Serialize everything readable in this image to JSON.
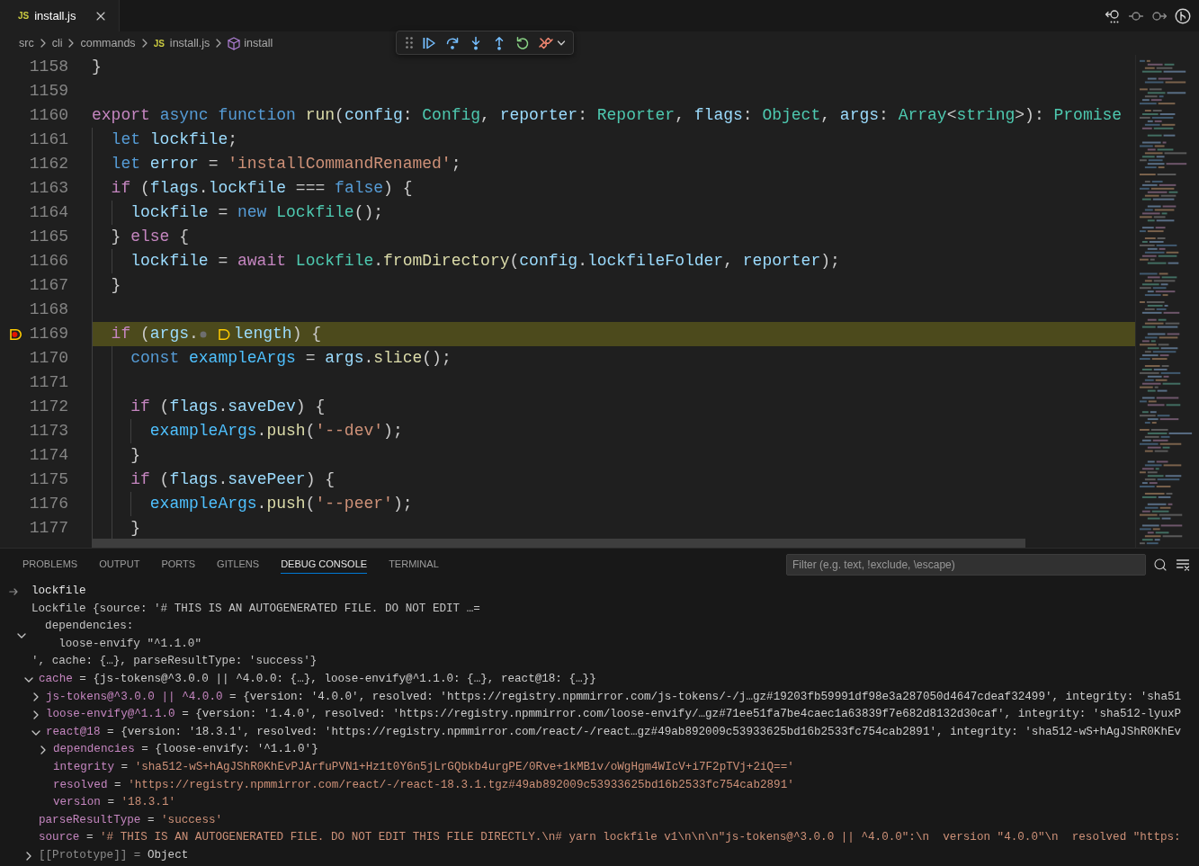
{
  "tabs": [
    {
      "file_icon": "JS",
      "label": "install.js",
      "selected": true
    }
  ],
  "breadcrumb": [
    {
      "label": "src",
      "kind": "folder"
    },
    {
      "label": "cli",
      "kind": "folder"
    },
    {
      "label": "commands",
      "kind": "folder"
    },
    {
      "label": "install.js",
      "kind": "file",
      "file_icon": "JS"
    },
    {
      "label": "install",
      "kind": "symbol"
    }
  ],
  "editor": {
    "lines": [
      {
        "number": "1158",
        "current": false,
        "breakpoint": false,
        "tokens": [
          {
            "text": "}",
            "kind": "plain"
          }
        ]
      },
      {
        "number": "1159",
        "current": false,
        "breakpoint": false
      },
      {
        "number": "1160",
        "current": false,
        "breakpoint": false,
        "tokens": [
          {
            "text": "export ",
            "kind": "control"
          },
          {
            "text": "async ",
            "kind": "keyword"
          },
          {
            "text": "function ",
            "kind": "keyword"
          },
          {
            "text": "run",
            "kind": "function"
          },
          {
            "text": "(",
            "kind": "plain"
          },
          {
            "text": "config",
            "kind": "variable"
          },
          {
            "text": ": ",
            "kind": "plain"
          },
          {
            "text": "Config",
            "kind": "type"
          },
          {
            "text": ", ",
            "kind": "plain"
          },
          {
            "text": "reporter",
            "kind": "variable"
          },
          {
            "text": ": ",
            "kind": "plain"
          },
          {
            "text": "Reporter",
            "kind": "type"
          },
          {
            "text": ", ",
            "kind": "plain"
          },
          {
            "text": "flags",
            "kind": "variable"
          },
          {
            "text": ": ",
            "kind": "plain"
          },
          {
            "text": "Object",
            "kind": "type"
          },
          {
            "text": ", ",
            "kind": "plain"
          },
          {
            "text": "args",
            "kind": "variable"
          },
          {
            "text": ": ",
            "kind": "plain"
          },
          {
            "text": "Array",
            "kind": "type"
          },
          {
            "text": "<",
            "kind": "plain"
          },
          {
            "text": "string",
            "kind": "type"
          },
          {
            "text": ">): ",
            "kind": "plain"
          },
          {
            "text": "Promise",
            "kind": "type"
          }
        ]
      },
      {
        "number": "1161",
        "current": false,
        "breakpoint": false,
        "tokens": [
          {
            "text": "  let ",
            "kind": "keyword"
          },
          {
            "text": "lockfile",
            "kind": "variable"
          },
          {
            "text": ";",
            "kind": "plain"
          }
        ]
      },
      {
        "number": "1162",
        "current": false,
        "breakpoint": false,
        "tokens": [
          {
            "text": "  let ",
            "kind": "keyword"
          },
          {
            "text": "error",
            "kind": "variable"
          },
          {
            "text": " = ",
            "kind": "plain"
          },
          {
            "text": "'installCommandRenamed'",
            "kind": "string"
          },
          {
            "text": ";",
            "kind": "plain"
          }
        ]
      },
      {
        "number": "1163",
        "current": false,
        "breakpoint": false,
        "tokens": [
          {
            "text": "  if",
            "kind": "control"
          },
          {
            "text": " (",
            "kind": "plain"
          },
          {
            "text": "flags",
            "kind": "variable"
          },
          {
            "text": ".",
            "kind": "plain"
          },
          {
            "text": "lockfile",
            "kind": "variable"
          },
          {
            "text": " === ",
            "kind": "plain"
          },
          {
            "text": "false",
            "kind": "keyword"
          },
          {
            "text": ") {",
            "kind": "plain"
          }
        ]
      },
      {
        "number": "1164",
        "current": false,
        "breakpoint": false,
        "tokens": [
          {
            "text": "    lockfile",
            "kind": "variable"
          },
          {
            "text": " = ",
            "kind": "plain"
          },
          {
            "text": "new ",
            "kind": "keyword"
          },
          {
            "text": "Lockfile",
            "kind": "type"
          },
          {
            "text": "();",
            "kind": "plain"
          }
        ]
      },
      {
        "number": "1165",
        "current": false,
        "breakpoint": false,
        "tokens": [
          {
            "text": "  } ",
            "kind": "plain"
          },
          {
            "text": "else",
            "kind": "control"
          },
          {
            "text": " {",
            "kind": "plain"
          }
        ]
      },
      {
        "number": "1166",
        "current": false,
        "breakpoint": false,
        "tokens": [
          {
            "text": "    lockfile",
            "kind": "variable"
          },
          {
            "text": " = ",
            "kind": "plain"
          },
          {
            "text": "await ",
            "kind": "control"
          },
          {
            "text": "Lockfile",
            "kind": "type"
          },
          {
            "text": ".",
            "kind": "plain"
          },
          {
            "text": "fromDirectory",
            "kind": "function"
          },
          {
            "text": "(",
            "kind": "plain"
          },
          {
            "text": "config",
            "kind": "variable"
          },
          {
            "text": ".",
            "kind": "plain"
          },
          {
            "text": "lockfileFolder",
            "kind": "variable"
          },
          {
            "text": ", ",
            "kind": "plain"
          },
          {
            "text": "reporter",
            "kind": "variable"
          },
          {
            "text": ");",
            "kind": "plain"
          }
        ]
      },
      {
        "number": "1167",
        "current": false,
        "breakpoint": false,
        "tokens": [
          {
            "text": "  }",
            "kind": "plain"
          }
        ]
      },
      {
        "number": "1168",
        "current": false,
        "breakpoint": false
      },
      {
        "number": "1169",
        "current": true,
        "breakpoint": true,
        "tokens": [
          {
            "text": "  if",
            "kind": "control"
          },
          {
            "text": " (",
            "kind": "plain"
          },
          {
            "text": "args",
            "kind": "variable"
          },
          {
            "text": ".",
            "kind": "plain"
          },
          {
            "kind": "breakpoint-dot"
          },
          {
            "kind": "frame-marker"
          },
          {
            "text": "length",
            "kind": "variable"
          },
          {
            "text": ") {",
            "kind": "plain"
          }
        ]
      },
      {
        "number": "1170",
        "current": false,
        "breakpoint": false,
        "tokens": [
          {
            "text": "    const ",
            "kind": "keyword"
          },
          {
            "text": "exampleArgs",
            "kind": "constant"
          },
          {
            "text": " = ",
            "kind": "plain"
          },
          {
            "text": "args",
            "kind": "variable"
          },
          {
            "text": ".",
            "kind": "plain"
          },
          {
            "text": "slice",
            "kind": "function"
          },
          {
            "text": "();",
            "kind": "plain"
          }
        ]
      },
      {
        "number": "1171",
        "current": false,
        "breakpoint": false
      },
      {
        "number": "1172",
        "current": false,
        "breakpoint": false,
        "tokens": [
          {
            "text": "    if",
            "kind": "control"
          },
          {
            "text": " (",
            "kind": "plain"
          },
          {
            "text": "flags",
            "kind": "variable"
          },
          {
            "text": ".",
            "kind": "plain"
          },
          {
            "text": "saveDev",
            "kind": "variable"
          },
          {
            "text": ") {",
            "kind": "plain"
          }
        ]
      },
      {
        "number": "1173",
        "current": false,
        "breakpoint": false,
        "tokens": [
          {
            "text": "      exampleArgs",
            "kind": "constant"
          },
          {
            "text": ".",
            "kind": "plain"
          },
          {
            "text": "push",
            "kind": "function"
          },
          {
            "text": "(",
            "kind": "plain"
          },
          {
            "text": "'--dev'",
            "kind": "string"
          },
          {
            "text": ");",
            "kind": "plain"
          }
        ]
      },
      {
        "number": "1174",
        "current": false,
        "breakpoint": false,
        "tokens": [
          {
            "text": "    }",
            "kind": "plain"
          }
        ]
      },
      {
        "number": "1175",
        "current": false,
        "breakpoint": false,
        "tokens": [
          {
            "text": "    if",
            "kind": "control"
          },
          {
            "text": " (",
            "kind": "plain"
          },
          {
            "text": "flags",
            "kind": "variable"
          },
          {
            "text": ".",
            "kind": "plain"
          },
          {
            "text": "savePeer",
            "kind": "variable"
          },
          {
            "text": ") {",
            "kind": "plain"
          }
        ]
      },
      {
        "number": "1176",
        "current": false,
        "breakpoint": false,
        "tokens": [
          {
            "text": "      exampleArgs",
            "kind": "constant"
          },
          {
            "text": ".",
            "kind": "plain"
          },
          {
            "text": "push",
            "kind": "function"
          },
          {
            "text": "(",
            "kind": "plain"
          },
          {
            "text": "'--peer'",
            "kind": "string"
          },
          {
            "text": ");",
            "kind": "plain"
          }
        ]
      },
      {
        "number": "1177",
        "current": false,
        "breakpoint": false,
        "tokens": [
          {
            "text": "    }",
            "kind": "plain"
          }
        ]
      }
    ]
  },
  "panel": {
    "tabs": [
      {
        "label": "PROBLEMS",
        "selected": false
      },
      {
        "label": "OUTPUT",
        "selected": false
      },
      {
        "label": "PORTS",
        "selected": false
      },
      {
        "label": "GITLENS",
        "selected": false
      },
      {
        "label": "DEBUG CONSOLE",
        "selected": true
      },
      {
        "label": "TERMINAL",
        "selected": false
      }
    ],
    "filter": {
      "placeholder": "Filter (e.g. text, !exclude, \\escape)"
    }
  },
  "debug_console": {
    "input": "lockfile",
    "result": {
      "expanded": true,
      "lines": [
        "Lockfile {source: '# THIS IS AN AUTOGENERATED FILE. DO NOT EDIT …=",
        "  dependencies:",
        "    loose-envify \"^1.1.0\"",
        "', cache: {…}, parseResultType: 'success'}"
      ],
      "children": [
        {
          "name": "cache",
          "sign": "=",
          "value": "{js-tokens@^3.0.0 || ^4.0.0: {…}, loose-envify@^1.1.0: {…}, react@18: {…}}",
          "kind": "object",
          "expanded": true,
          "children": [
            {
              "name": "js-tokens@^3.0.0 || ^4.0.0",
              "sign": "=",
              "value": "{version: '4.0.0', resolved: 'https://registry.npmmirror.com/js-tokens/-/j…gz#19203fb59991df98e3a287050d4647cdeaf32499', integrity: 'sha51",
              "kind": "object",
              "expanded": false
            },
            {
              "name": "loose-envify@^1.1.0",
              "sign": "=",
              "value": "{version: '1.4.0', resolved: 'https://registry.npmmirror.com/loose-envify/…gz#71ee51fa7be4caec1a63839f7e682d8132d30caf', integrity: 'sha512-lyuxP",
              "kind": "object",
              "expanded": false
            },
            {
              "name": "react@18",
              "sign": "=",
              "value": "{version: '18.3.1', resolved: 'https://registry.npmmirror.com/react/-/react…gz#49ab892009c53933625bd16b2533fc754cab2891', integrity: 'sha512-wS+hAgJShR0KhEv",
              "kind": "object",
              "expanded": true,
              "children": [
                {
                  "name": "dependencies",
                  "sign": "=",
                  "value": "{loose-envify: '^1.1.0'}",
                  "kind": "object",
                  "expanded": false
                },
                {
                  "name": "integrity",
                  "sign": "=",
                  "value": "'sha512-wS+hAgJShR0KhEvPJArfuPVN1+Hz1t0Y6n5jLrGQbkb4urgPE/0Rve+1kMB1v/oWgHgm4WIcV+i7F2pTVj+2iQ=='",
                  "kind": "string"
                },
                {
                  "name": "resolved",
                  "sign": "=",
                  "value": "'https://registry.npmmirror.com/react/-/react-18.3.1.tgz#49ab892009c53933625bd16b2533fc754cab2891'",
                  "kind": "string"
                },
                {
                  "name": "version",
                  "sign": "=",
                  "value": "'18.3.1'",
                  "kind": "string"
                }
              ]
            }
          ]
        },
        {
          "name": "parseResultType",
          "sign": "=",
          "value": "'success'",
          "kind": "string"
        },
        {
          "name": "source",
          "sign": "=",
          "value": "'# THIS IS AN AUTOGENERATED FILE. DO NOT EDIT THIS FILE DIRECTLY.\\n# yarn lockfile v1\\n\\n\\n\"js-tokens@^3.0.0 || ^4.0.0\":\\n  version \"4.0.0\"\\n  resolved \"https:",
          "kind": "string"
        },
        {
          "name": "[[Prototype]]",
          "sign": "=",
          "value": "Object",
          "kind": "internal",
          "expanded": false
        }
      ]
    }
  }
}
